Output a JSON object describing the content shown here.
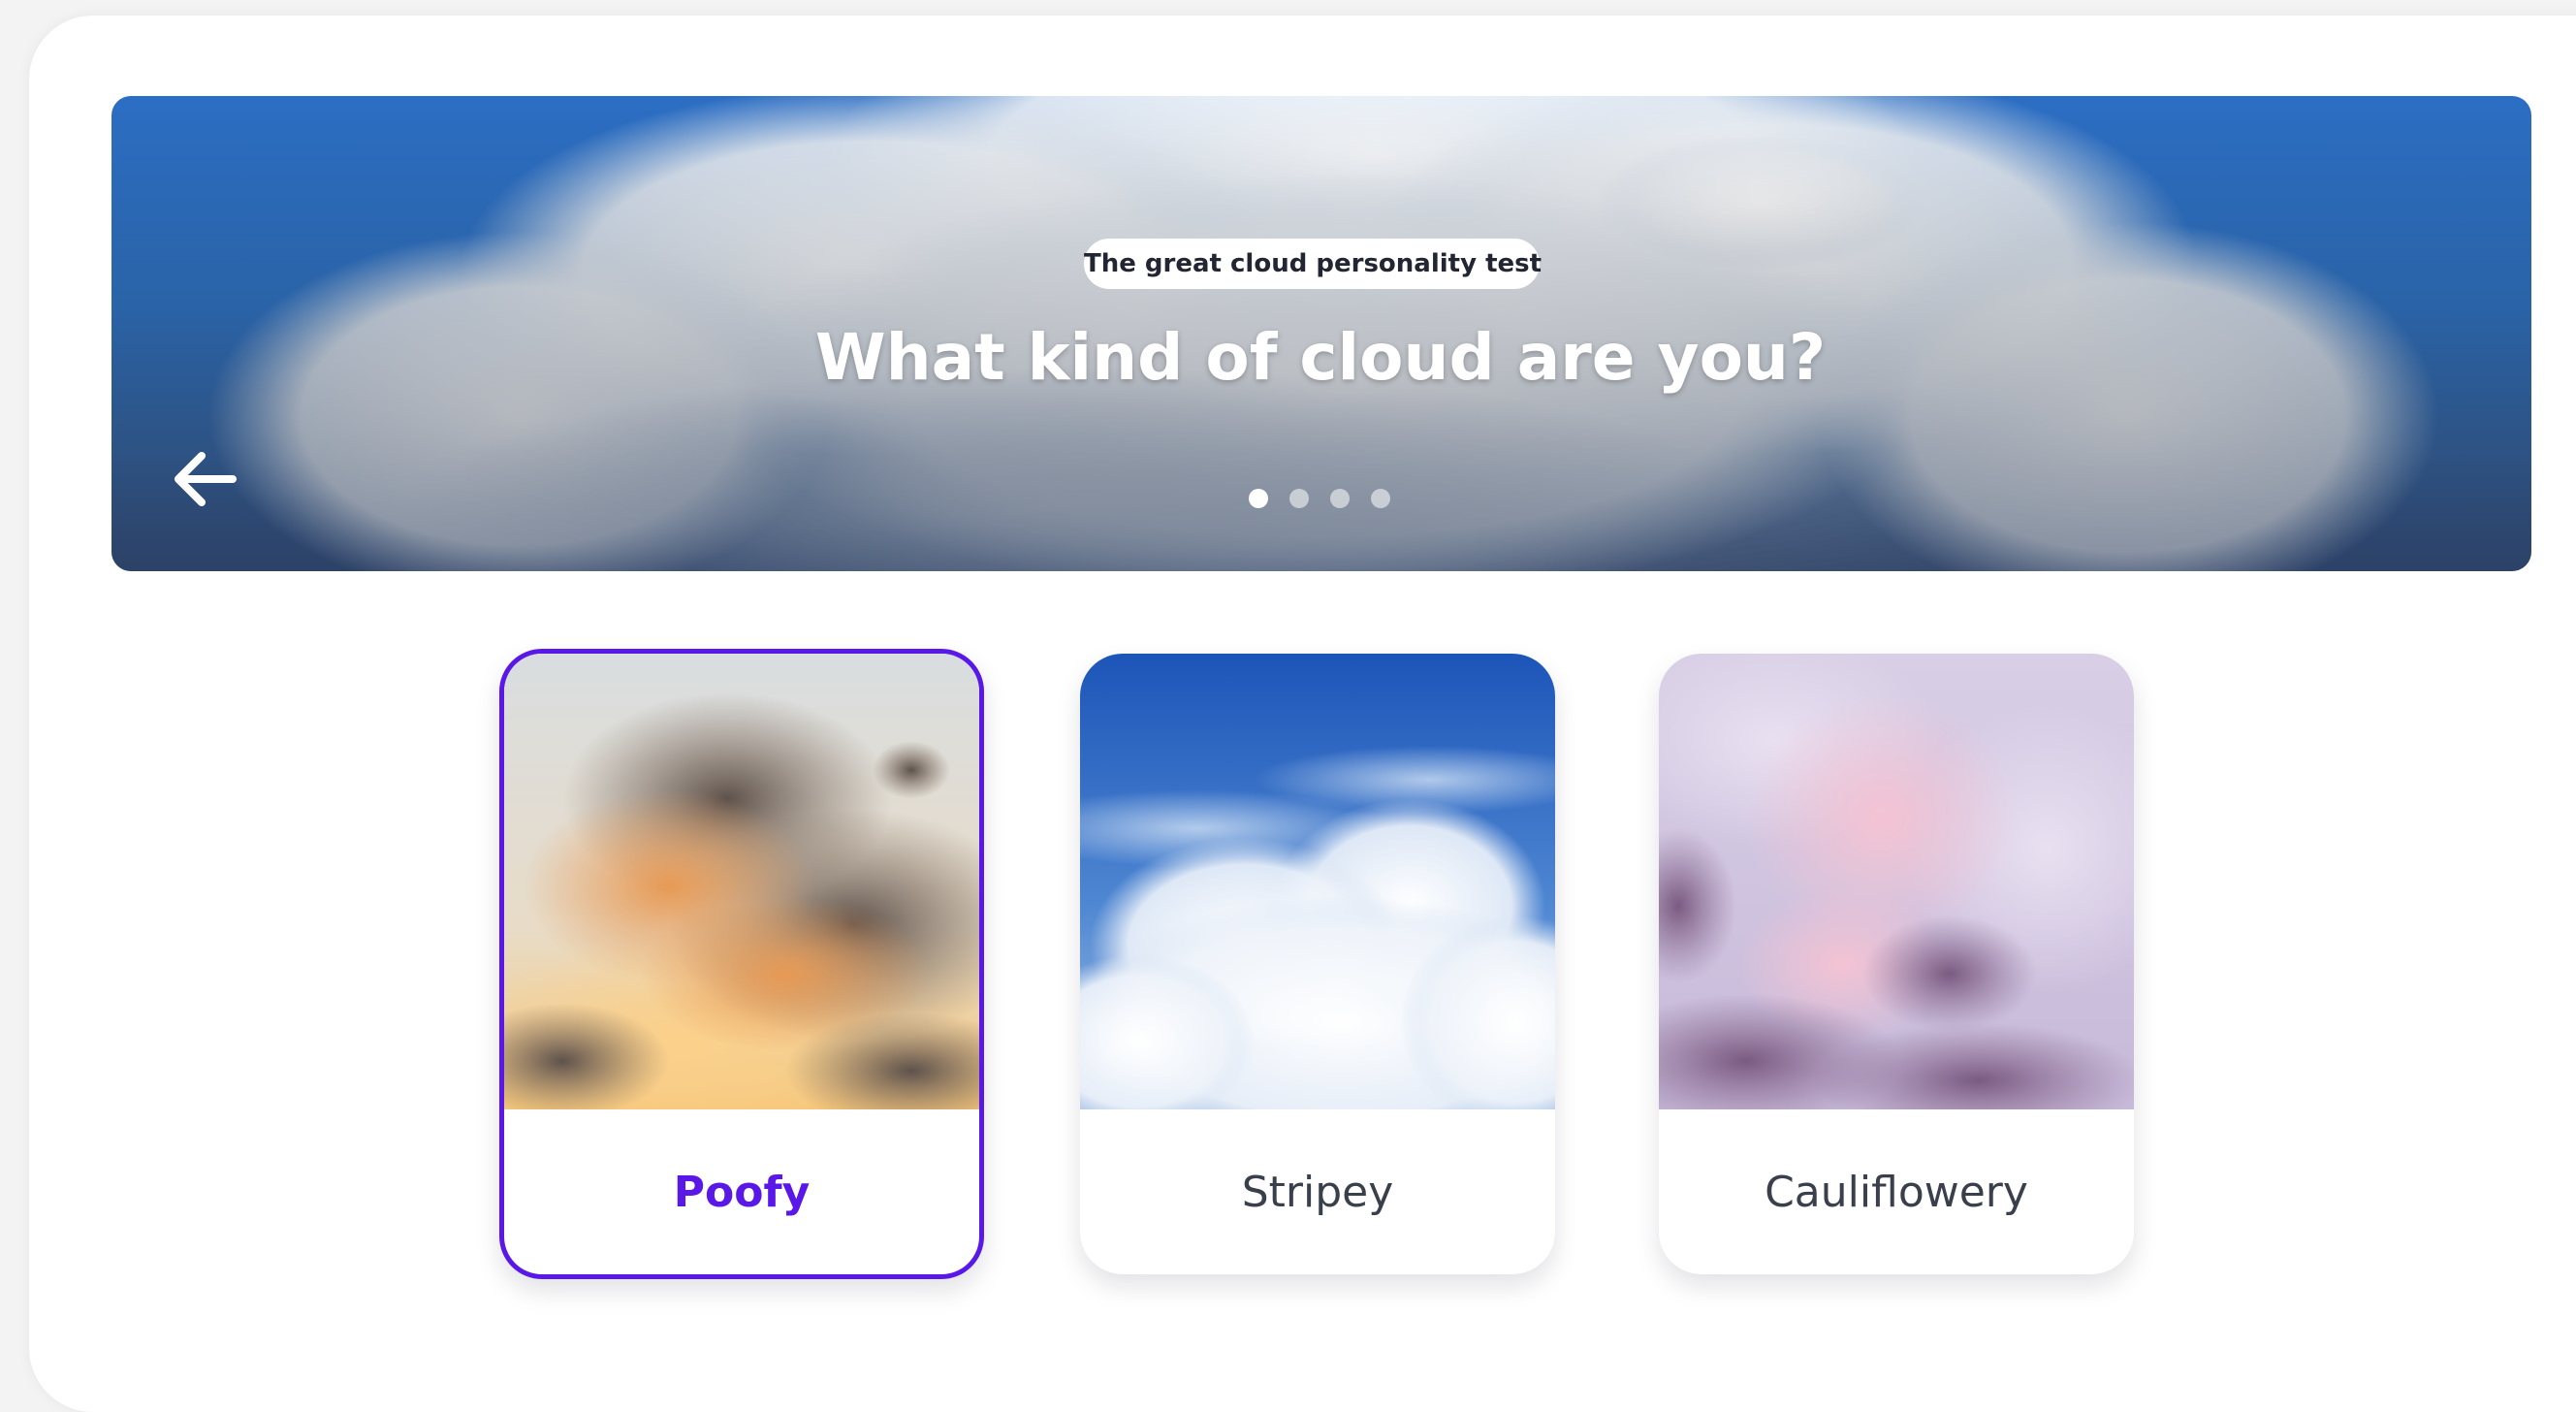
{
  "hero": {
    "tag": "The great cloud personality test",
    "title": "What kind of cloud are you?",
    "back_icon": "arrow-left-icon",
    "pagination": {
      "count": 4,
      "active_index": 0
    }
  },
  "options": [
    {
      "label": "Poofy",
      "selected": true
    },
    {
      "label": "Stripey",
      "selected": false
    },
    {
      "label": "Cauliflowery",
      "selected": false
    }
  ],
  "colors": {
    "accent": "#5a18e8",
    "sky": "#3277c9",
    "text": "#3a3f4c"
  }
}
